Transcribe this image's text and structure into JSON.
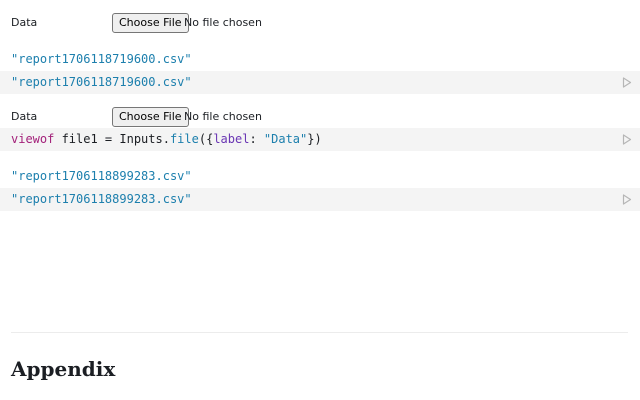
{
  "file_input_1": {
    "label": "Data",
    "button_label": "Choose File",
    "status": "No file chosen"
  },
  "output_1": {
    "value": "\"report1706118719600.csv\""
  },
  "cell_1": {
    "code_string": "\"report1706118719600.csv\""
  },
  "file_input_2": {
    "label": "Data",
    "button_label": "Choose File",
    "status": "No file chosen"
  },
  "cell_2": {
    "code_viewof": "viewof",
    "code_var": " file1 = Inputs.",
    "code_fn": "file",
    "code_open": "({",
    "code_key": "label",
    "code_colon": ": ",
    "code_str": "\"Data\"",
    "code_close": "})"
  },
  "output_2": {
    "value": "\"report1706118899283.csv\""
  },
  "cell_3": {
    "code_string": "\"report1706118899283.csv\""
  },
  "appendix": {
    "heading": "Appendix"
  },
  "colors": {
    "cell_bg": "#f4f4f4",
    "string": "#1c7fad",
    "keyword": "#a3217a",
    "property": "#6a36b4"
  },
  "icons": {
    "run": "play-triangle-icon"
  }
}
